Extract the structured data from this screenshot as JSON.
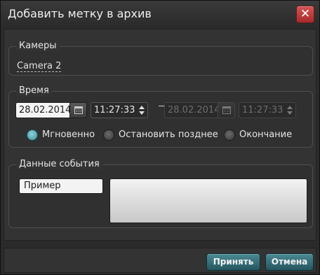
{
  "window": {
    "title": "Добавить метку в архив",
    "close_glyph": "✕"
  },
  "cameras": {
    "legend": "Камеры",
    "selected": "Camera 2"
  },
  "time": {
    "legend": "Время",
    "start_date": "28.02.2014",
    "start_time": "11:27:33",
    "end_date": "28.02.2014",
    "end_time": "11:27:33",
    "modes": [
      {
        "label": "Мгновенно",
        "selected": true
      },
      {
        "label": "Остановить позднее",
        "selected": false
      },
      {
        "label": "Окончание",
        "selected": false
      }
    ]
  },
  "event": {
    "legend": "Данные события",
    "name_value": "Пример",
    "details_value": ""
  },
  "footer": {
    "accept_label": "Принять",
    "cancel_label": "Отмена"
  },
  "colors": {
    "accent": "#3a7a84",
    "close": "#c13c3c",
    "background": "#2b2b2b"
  }
}
